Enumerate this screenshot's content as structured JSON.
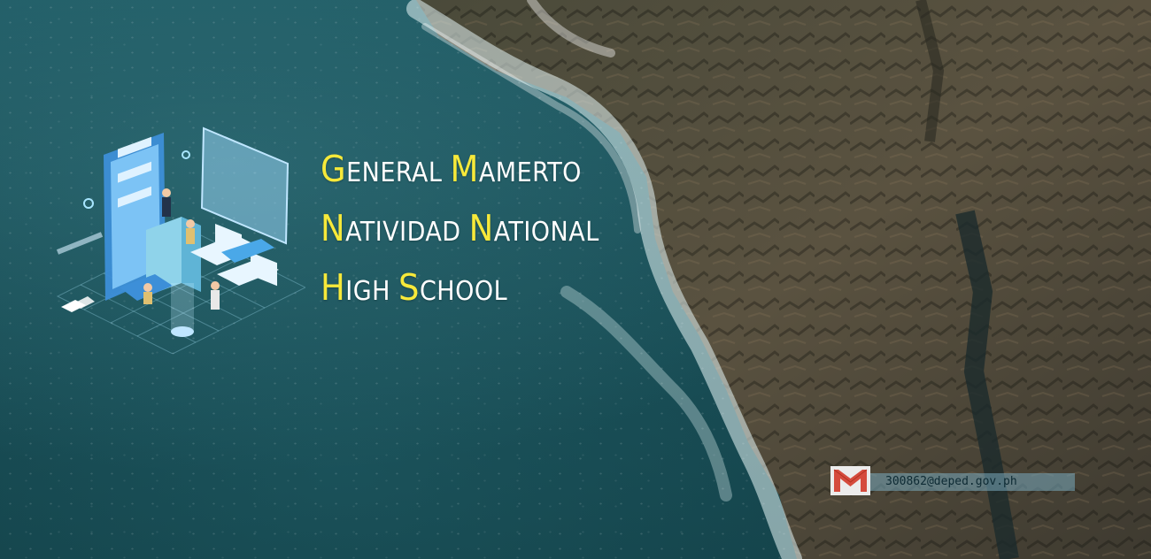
{
  "school": {
    "title_lines": [
      [
        {
          "cap": "G",
          "rest": "ENERAL"
        },
        {
          "cap": "M",
          "rest": "AMERTO"
        }
      ],
      [
        {
          "cap": "N",
          "rest": "ATIVIDAD"
        },
        {
          "cap": "N",
          "rest": "ATIONAL"
        }
      ],
      [
        {
          "cap": "H",
          "rest": "IGH"
        },
        {
          "cap": "S",
          "rest": "CHOOL"
        }
      ]
    ]
  },
  "contact": {
    "email": "300862@deped.gov.ph",
    "icon": "gmail-icon"
  },
  "colors": {
    "accent": "#f7e93a",
    "text": "#ffffff"
  }
}
